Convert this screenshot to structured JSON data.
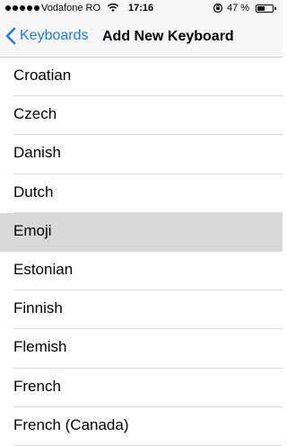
{
  "status_bar": {
    "carrier": "Vodafone RO",
    "time": "17:16",
    "battery_percent": "47 %",
    "battery_level": 0.47
  },
  "nav": {
    "back_label": "Keyboards",
    "title": "Add New Keyboard"
  },
  "keyboards": [
    {
      "label": "Croatian",
      "selected": false
    },
    {
      "label": "Czech",
      "selected": false
    },
    {
      "label": "Danish",
      "selected": false
    },
    {
      "label": "Dutch",
      "selected": false
    },
    {
      "label": "Emoji",
      "selected": true
    },
    {
      "label": "Estonian",
      "selected": false
    },
    {
      "label": "Finnish",
      "selected": false
    },
    {
      "label": "Flemish",
      "selected": false
    },
    {
      "label": "French",
      "selected": false
    },
    {
      "label": "French (Canada)",
      "selected": false
    }
  ],
  "colors": {
    "accent": "#1a7cf5",
    "selected_row": "#d9d9d9",
    "bar_background": "#f7f7f7"
  }
}
